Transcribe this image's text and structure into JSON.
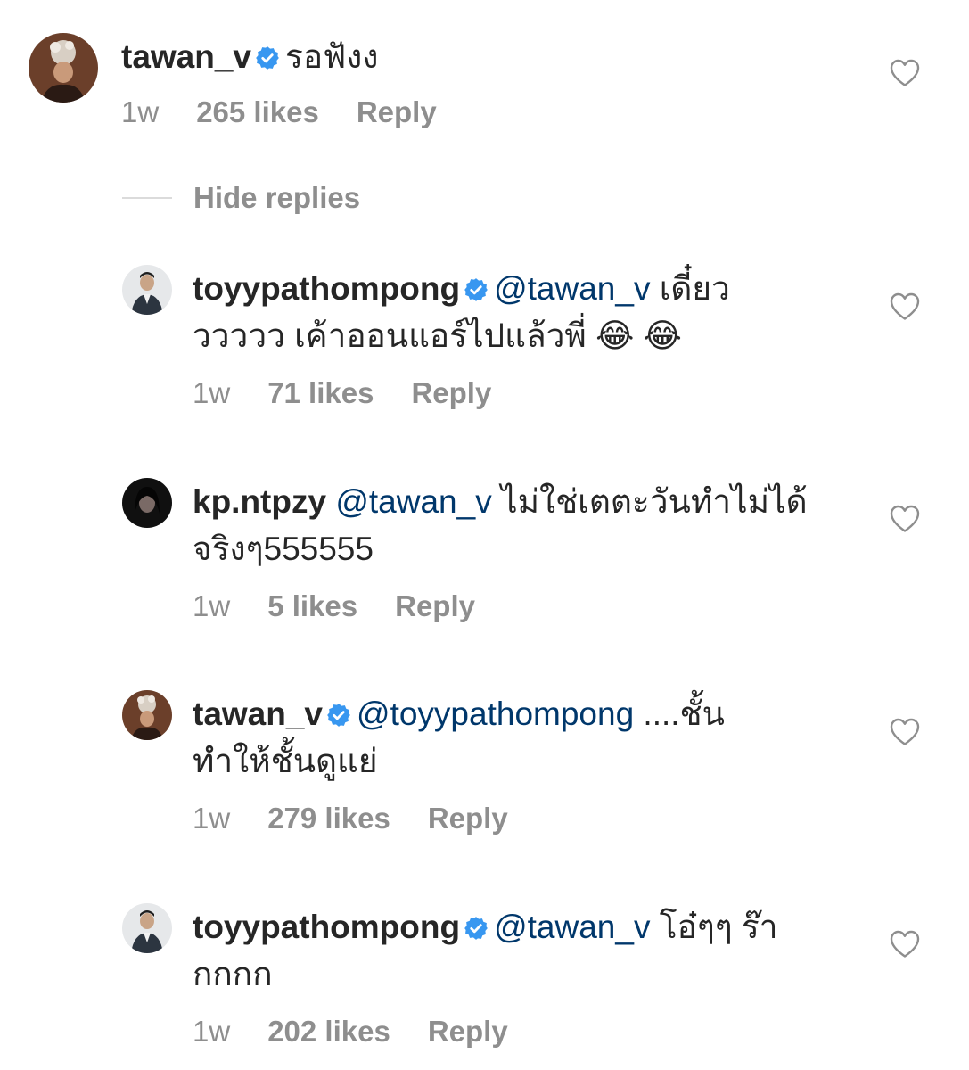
{
  "colors": {
    "text": "#262626",
    "secondary": "#8e8e8e",
    "mention": "#00376b",
    "verified": "#3897f0"
  },
  "comments": [
    {
      "username": "tawan_v",
      "verified": true,
      "mention": "",
      "text": "รอฟังง",
      "time": "1w",
      "likes": "265 likes",
      "reply": "Reply",
      "icon": "heart-outline-icon"
    },
    {
      "username": "toyypathompong",
      "verified": true,
      "mention": "@tawan_v",
      "text": " เดี๋ยว",
      "text2": "ววววว เค้าออนแอร์ไปแล้วพี่ 😂 😂",
      "time": "1w",
      "likes": "71 likes",
      "reply": "Reply",
      "icon": "heart-outline-icon"
    },
    {
      "username": "kp.ntpzy",
      "verified": false,
      "mention": "@tawan_v",
      "text": " ไม่ใช่เตตะวันทำไม่ได้",
      "text2": "จริงๆ555555",
      "time": "1w",
      "likes": "5 likes",
      "reply": "Reply",
      "icon": "heart-outline-icon"
    },
    {
      "username": "tawan_v",
      "verified": true,
      "mention": "@toyypathompong",
      "text": " ....ชั้น",
      "text2": "ทำให้ชั้นดูแย่",
      "time": "1w",
      "likes": "279 likes",
      "reply": "Reply",
      "icon": "heart-outline-icon"
    },
    {
      "username": "toyypathompong",
      "verified": true,
      "mention": "@tawan_v",
      "text": " โอ๋ๆๆ ร๊า",
      "text2": "กกกก",
      "time": "1w",
      "likes": "202 likes",
      "reply": "Reply",
      "icon": "heart-outline-icon"
    }
  ],
  "hide_replies": "Hide replies"
}
